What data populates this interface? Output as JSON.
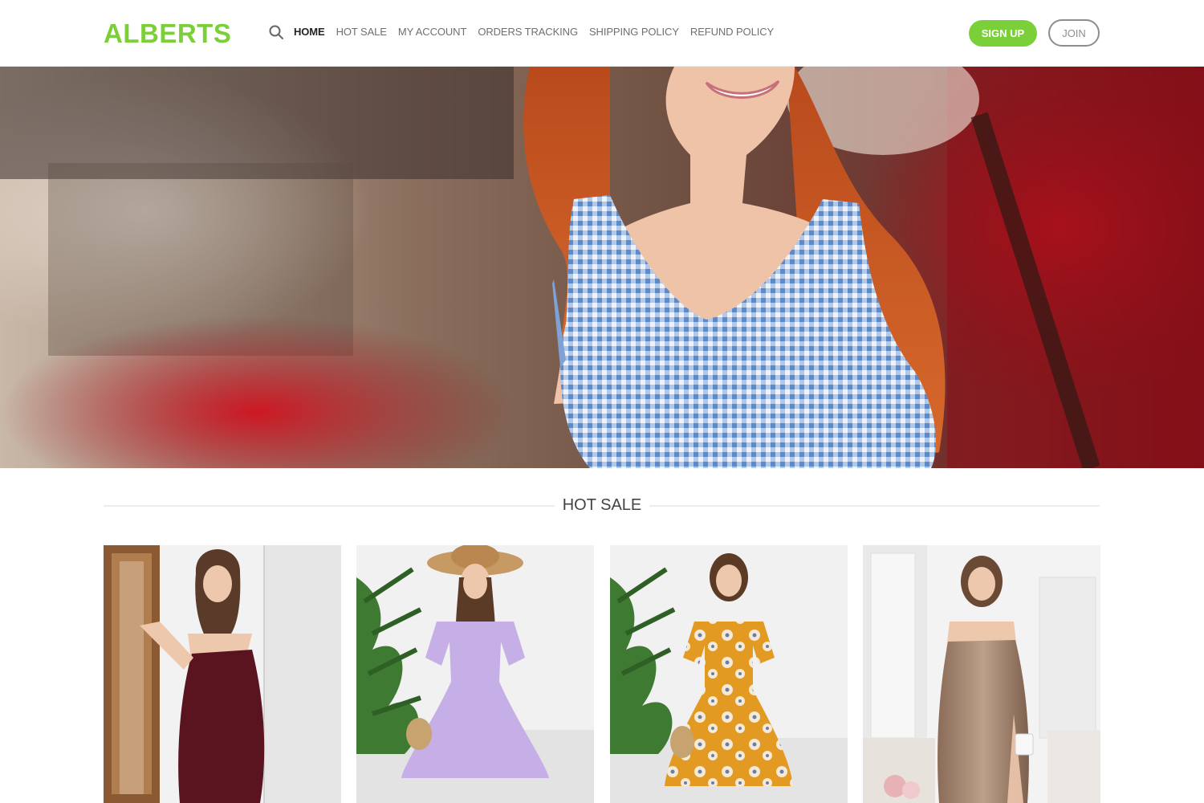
{
  "header": {
    "logo": "ALBERTS",
    "nav": [
      {
        "label": "HOME",
        "active": true
      },
      {
        "label": "HOT SALE",
        "active": false
      },
      {
        "label": "MY ACCOUNT",
        "active": false
      },
      {
        "label": "ORDERS TRACKING",
        "active": false
      },
      {
        "label": "SHIPPING POLICY",
        "active": false
      },
      {
        "label": "REFUND POLICY",
        "active": false
      }
    ],
    "signup_label": "SIGN UP",
    "join_label": "JOIN"
  },
  "section": {
    "title": "HOT SALE"
  },
  "colors": {
    "accent": "#7bd03a",
    "text": "#444444",
    "nav_text": "#6f6f6f",
    "outline": "#8d8d8d"
  },
  "icons": {
    "search": "search-icon"
  },
  "products": [
    {
      "image": "burgundy-slip-maxi-dress",
      "dress_color": "#5a1420"
    },
    {
      "image": "lavender-polka-dot-midi-dress",
      "dress_color": "#c6aee6"
    },
    {
      "image": "orange-floral-midi-dress",
      "dress_color": "#e39a22"
    },
    {
      "image": "taupe-satin-slip-dress",
      "dress_color": "#a3846f"
    }
  ]
}
